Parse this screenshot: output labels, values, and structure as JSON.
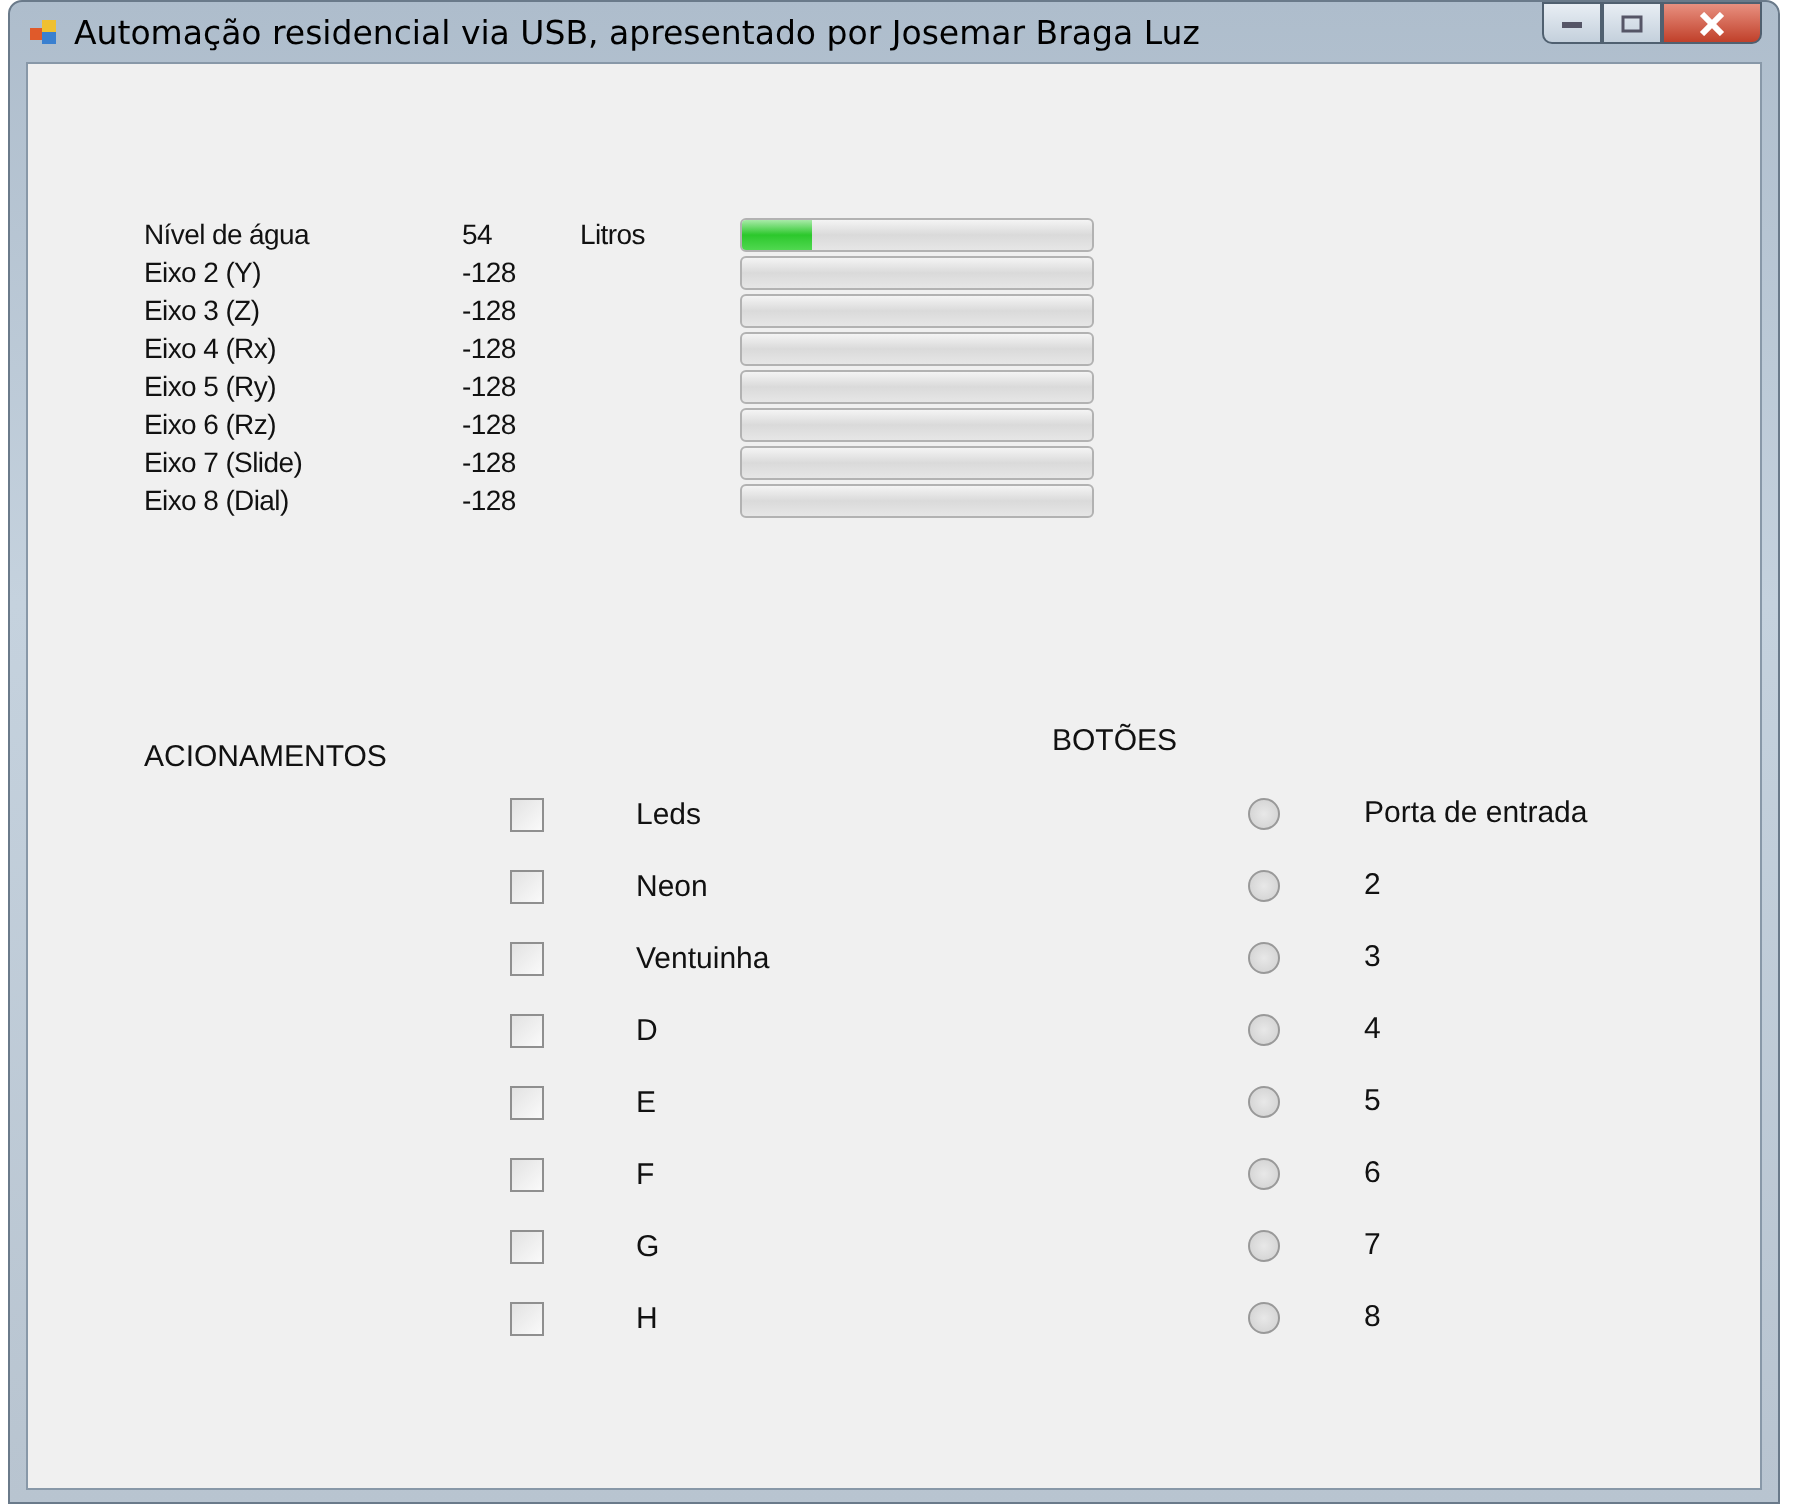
{
  "window": {
    "title": "Automação residencial via USB, apresentado por Josemar Braga Luz"
  },
  "axes": [
    {
      "label": "Nível  de água",
      "value": "54",
      "unit": "Litros",
      "level": 0.2
    },
    {
      "label": "Eixo 2 (Y)",
      "value": "-128"
    },
    {
      "label": "Eixo 3 (Z)",
      "value": "-128"
    },
    {
      "label": "Eixo 4 (Rx)",
      "value": "-128"
    },
    {
      "label": "Eixo 5 (Ry)",
      "value": "-128"
    },
    {
      "label": "Eixo 6 (Rz)",
      "value": "-128"
    },
    {
      "label": "Eixo 7 (Slide)",
      "value": "-128"
    },
    {
      "label": "Eixo 8 (Dial)",
      "value": "-128"
    }
  ],
  "actuators": {
    "title": "ACIONAMENTOS",
    "items": [
      {
        "label": "Leds",
        "checked": false
      },
      {
        "label": "Neon",
        "checked": false
      },
      {
        "label": "Ventuinha",
        "checked": false
      },
      {
        "label": "D",
        "checked": false
      },
      {
        "label": "E",
        "checked": false
      },
      {
        "label": "F",
        "checked": false
      },
      {
        "label": "G",
        "checked": false
      },
      {
        "label": "H",
        "checked": false
      }
    ]
  },
  "buttons": {
    "title": "BOTÕES",
    "items": [
      {
        "label": "Porta de entrada",
        "selected": false
      },
      {
        "label": "2",
        "selected": false
      },
      {
        "label": "3",
        "selected": false
      },
      {
        "label": "4",
        "selected": false
      },
      {
        "label": "5",
        "selected": false
      },
      {
        "label": "6",
        "selected": false
      },
      {
        "label": "7",
        "selected": false
      },
      {
        "label": "8",
        "selected": false
      }
    ]
  }
}
